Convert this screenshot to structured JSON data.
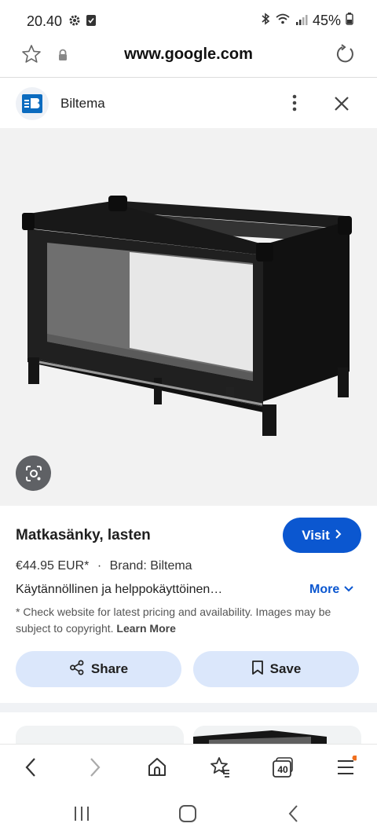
{
  "status_bar": {
    "time": "20.40",
    "battery": "45%",
    "icons": [
      "gear-icon",
      "checkbox-icon",
      "bluetooth-icon",
      "wifi-icon",
      "signal-icon",
      "battery-icon"
    ]
  },
  "address_bar": {
    "url": "www.google.com"
  },
  "site_header": {
    "name": "Biltema",
    "brand_color": "#0b6bbf"
  },
  "product": {
    "title": "Matkasänky, lasten",
    "visit_label": "Visit",
    "price": "€44.95 EUR*",
    "separator": "·",
    "brand": "Brand: Biltema",
    "description": "Käytännöllinen ja helppokäyttöinen…",
    "more_label": "More",
    "disclaimer": "* Check website for latest pricing and availability. Images may be subject to copyright.",
    "learn_more": "Learn More",
    "share_label": "Share",
    "save_label": "Save"
  },
  "toolbar": {
    "tab_count": "40",
    "items": [
      "back-icon",
      "forward-icon",
      "home-icon",
      "bookmarks-icon",
      "tabs-icon",
      "menu-icon"
    ]
  },
  "colors": {
    "accent": "#0b57d0",
    "pill_bg": "#dbe7fb",
    "notification_dot": "#f0701f"
  }
}
